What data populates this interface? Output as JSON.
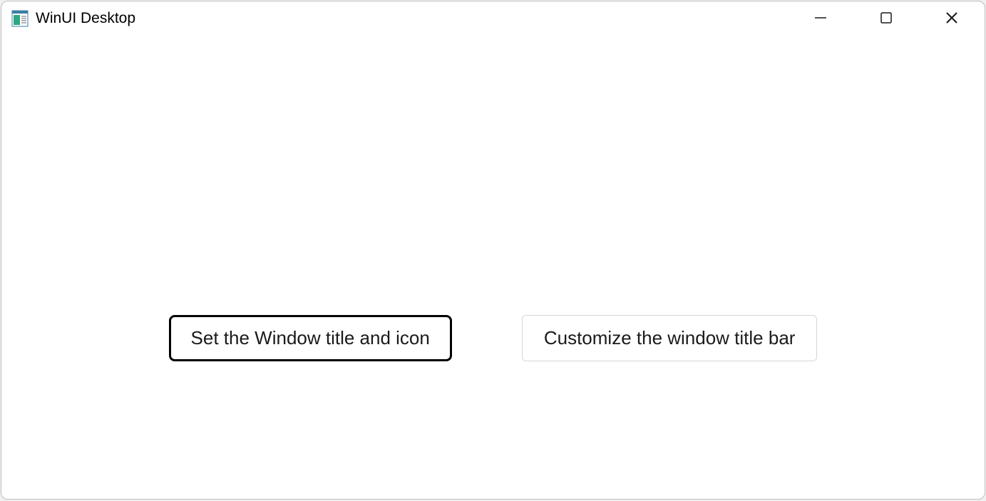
{
  "window": {
    "title": "WinUI Desktop",
    "icons": {
      "app": "app-window-icon",
      "minimize": "minimize-icon",
      "maximize": "maximize-icon",
      "close": "close-icon"
    }
  },
  "content": {
    "buttons": {
      "set_title": "Set the Window title and icon",
      "customize_titlebar": "Customize the window title bar"
    }
  }
}
